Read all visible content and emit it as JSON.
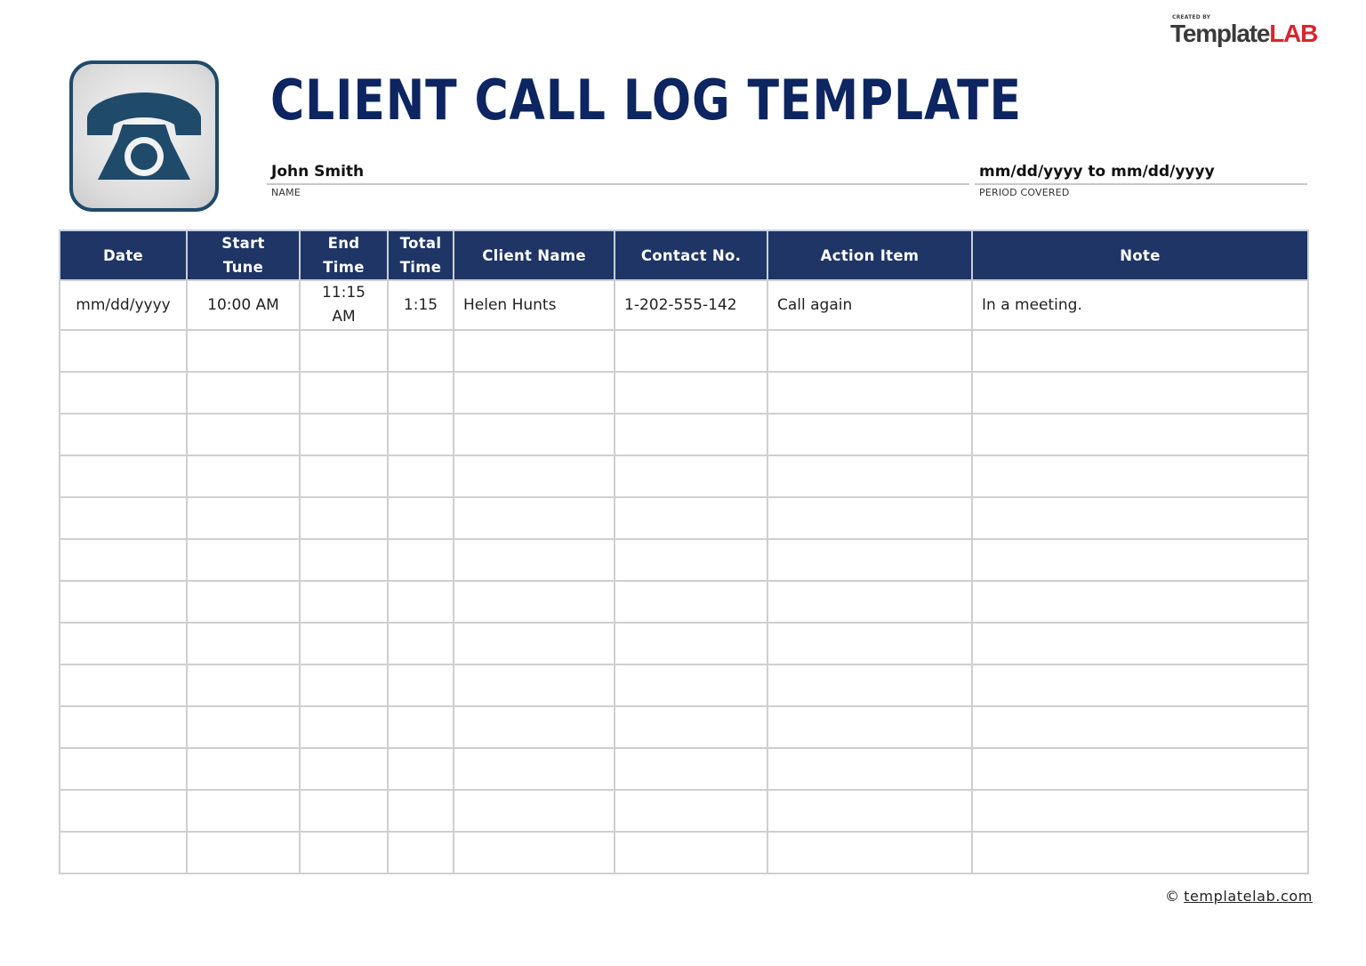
{
  "brand": {
    "created_by": "CREATED BY",
    "name_part1": "Template",
    "name_part2": "LAB"
  },
  "logo": {
    "icon": "telephone-icon",
    "color": "#1f4a6a"
  },
  "title": "CLIENT CALL LOG TEMPLATE",
  "fields": {
    "name": {
      "value": "John Smith",
      "label": "NAME"
    },
    "period": {
      "value": "mm/dd/yyyy to mm/dd/yyyy",
      "label": "PERIOD COVERED"
    }
  },
  "colors": {
    "title": "#0d2560",
    "header_bg": "#1f3566",
    "header_text": "#ffffff",
    "grid": "#cfcfcf",
    "brand_accent": "#d8262e"
  },
  "table": {
    "headers": [
      {
        "line1": "Date",
        "line2": ""
      },
      {
        "line1": "Start",
        "line2": "Tune"
      },
      {
        "line1": "End",
        "line2": "Time"
      },
      {
        "line1": "Total",
        "line2": "Time"
      },
      {
        "line1": "Client Name",
        "line2": ""
      },
      {
        "line1": "Contact No.",
        "line2": ""
      },
      {
        "line1": "Action Item",
        "line2": ""
      },
      {
        "line1": "Note",
        "line2": ""
      }
    ],
    "rows": [
      {
        "date": "mm/dd/yyyy",
        "start_time": "10:00 AM",
        "end_time_line1": "11:15",
        "end_time_line2": "AM",
        "total_time": "1:15",
        "client_name": "Helen Hunts",
        "contact_no": "1-202-555-142",
        "action_item": "Call again",
        "note": "In a meeting."
      }
    ],
    "empty_row_count": 13
  },
  "footer": {
    "copyright_symbol": "©",
    "link_text": "templatelab.com"
  }
}
